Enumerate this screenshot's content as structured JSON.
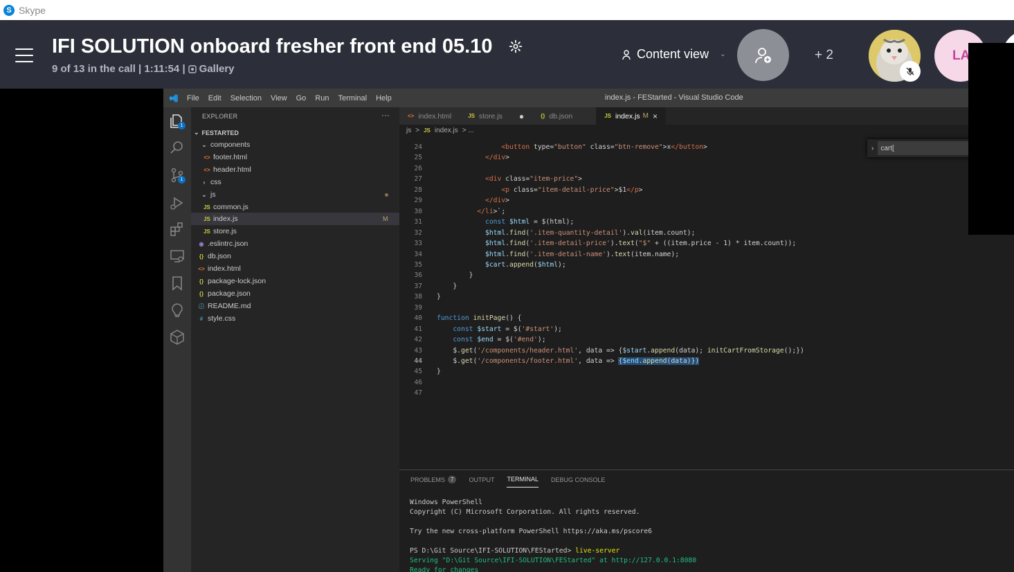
{
  "skype": {
    "app_name": "Skype",
    "logo_letter": "S",
    "call_title": "IFI SOLUTION onboard fresher front end 05.10",
    "call_status": "9 of 13 in the call | 1:11:54 |",
    "gallery_label": "Gallery",
    "content_view_label": "Content view",
    "participants_extra": "+ 2",
    "avatar2_initials": "LA"
  },
  "vscode": {
    "menu": [
      "File",
      "Edit",
      "Selection",
      "View",
      "Go",
      "Run",
      "Terminal",
      "Help"
    ],
    "window_title": "index.js - FEStarted - Visual Studio Code",
    "activity_badges": {
      "explorer": "1",
      "scm": "1"
    },
    "explorer": {
      "title": "EXPLORER",
      "more": "···",
      "folder": "FESTARTED",
      "items": [
        {
          "label": "components",
          "icon": "folder-open-chevron",
          "indent": 1
        },
        {
          "label": "footer.html",
          "icon": "html-icon",
          "indent": 2
        },
        {
          "label": "header.html",
          "icon": "html-icon",
          "indent": 2
        },
        {
          "label": "css",
          "icon": "folder-closed-chevron",
          "indent": 1
        },
        {
          "label": "js",
          "icon": "folder-open-chevron",
          "indent": 1
        },
        {
          "label": "common.js",
          "icon": "js-icon",
          "indent": 2
        },
        {
          "label": "index.js",
          "icon": "js-icon",
          "indent": 2,
          "status": "M"
        },
        {
          "label": "store.js",
          "icon": "js-icon",
          "indent": 2
        },
        {
          "label": ".eslintrc.json",
          "icon": "eslint-icon",
          "indent": 1
        },
        {
          "label": "db.json",
          "icon": "json-icon",
          "indent": 1
        },
        {
          "label": "index.html",
          "icon": "html-icon",
          "indent": 1
        },
        {
          "label": "package-lock.json",
          "icon": "json-icon",
          "indent": 1
        },
        {
          "label": "package.json",
          "icon": "json-icon",
          "indent": 1
        },
        {
          "label": "README.md",
          "icon": "info-icon",
          "indent": 1
        },
        {
          "label": "style.css",
          "icon": "hash-icon",
          "indent": 1
        }
      ]
    },
    "tabs": [
      {
        "label": "index.html",
        "icon": "<>"
      },
      {
        "label": "store.js",
        "icon": "JS",
        "unsaved": "●"
      },
      {
        "label": "db.json",
        "icon": "{}"
      },
      {
        "label": "index.js",
        "icon": "JS",
        "modified": "M",
        "close": "×"
      }
    ],
    "breadcrumb": [
      "js",
      ">",
      "JS",
      "index.js",
      "> ..."
    ],
    "find_value": "cart[",
    "code_lines": [
      {
        "n": "24",
        "text": "                <button type=\"button\" class=\"btn-remove\">x</button>"
      },
      {
        "n": "25",
        "text": "            </div>"
      },
      {
        "n": "26",
        "text": ""
      },
      {
        "n": "27",
        "text": "            <div class=\"item-price\">"
      },
      {
        "n": "28",
        "text": "                <p class=\"item-detail-price\">$1</p>"
      },
      {
        "n": "29",
        "text": "            </div>"
      },
      {
        "n": "30",
        "text": "          </li>`;"
      },
      {
        "n": "31",
        "text": "            const $html = $(html);"
      },
      {
        "n": "32",
        "text": "            $html.find('.item-quantity-detail').val(item.count);"
      },
      {
        "n": "33",
        "text": "            $html.find('.item-detail-price').text(\"$\" + ((item.price - 1) * item.count));"
      },
      {
        "n": "34",
        "text": "            $html.find('.item-detail-name').text(item.name);"
      },
      {
        "n": "35",
        "text": "            $cart.append($html);"
      },
      {
        "n": "36",
        "text": "        }"
      },
      {
        "n": "37",
        "text": "    }"
      },
      {
        "n": "38",
        "text": "}"
      },
      {
        "n": "39",
        "text": ""
      },
      {
        "n": "40",
        "text": "function initPage() {"
      },
      {
        "n": "41",
        "text": "    const $start = $('#start');"
      },
      {
        "n": "42",
        "text": "    const $end = $('#end');"
      },
      {
        "n": "43",
        "text": "    $.get('/components/header.html', data => {$start.append(data); initCartFromStorage();})"
      },
      {
        "n": "44",
        "text": "    $.get('/components/footer.html', data => {$end.append(data)})"
      },
      {
        "n": "45",
        "text": "}"
      },
      {
        "n": "46",
        "text": ""
      },
      {
        "n": "47",
        "text": ""
      }
    ],
    "panel": {
      "tabs": [
        "PROBLEMS",
        "OUTPUT",
        "TERMINAL",
        "DEBUG CONSOLE"
      ],
      "problems_count": "7",
      "terminal_lines": [
        "Windows PowerShell",
        "Copyright (C) Microsoft Corporation. All rights reserved.",
        "",
        "Try the new cross-platform PowerShell https://aka.ms/pscore6",
        "",
        "PS D:\\Git Source\\IFI-SOLUTION\\FEStarted> ",
        "Serving \"D:\\Git Source\\IFI-SOLUTION\\FEStarted\" at http://127.0.0.1:8080",
        "Ready for changes"
      ],
      "terminal_command": "live-server"
    }
  }
}
